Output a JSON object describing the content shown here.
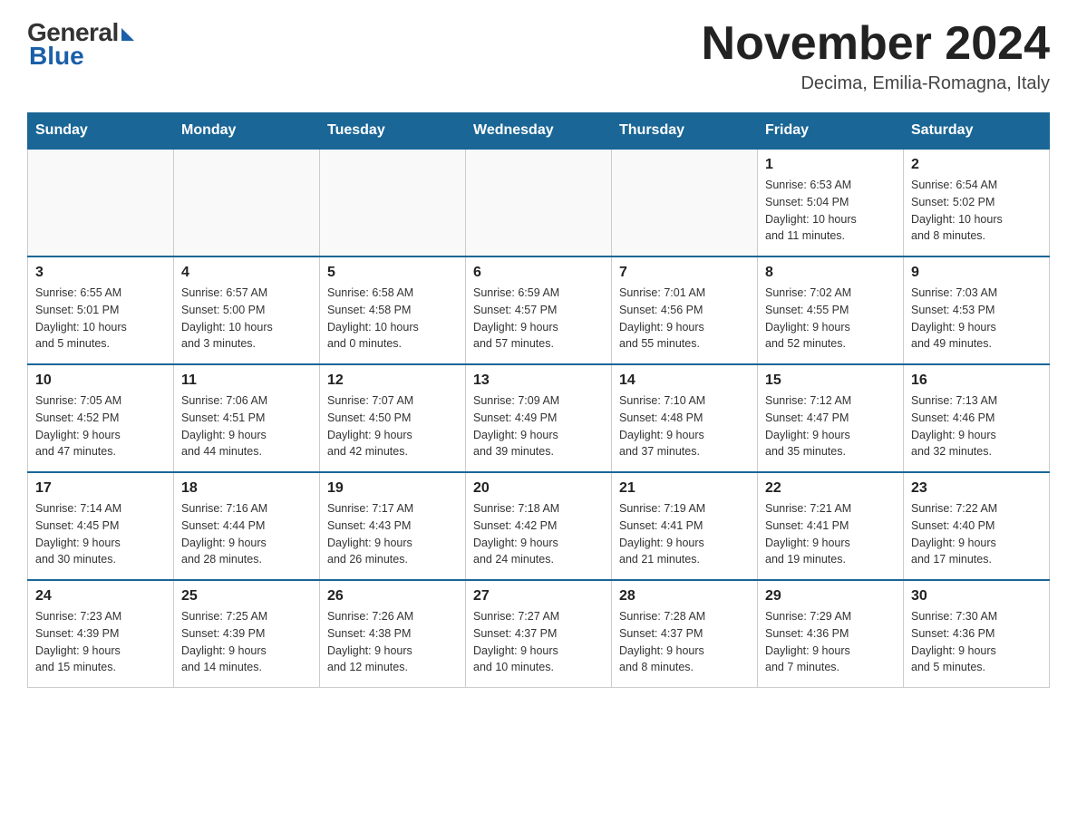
{
  "header": {
    "logo": {
      "general": "General",
      "blue": "Blue"
    },
    "title": "November 2024",
    "subtitle": "Decima, Emilia-Romagna, Italy"
  },
  "weekdays": [
    "Sunday",
    "Monday",
    "Tuesday",
    "Wednesday",
    "Thursday",
    "Friday",
    "Saturday"
  ],
  "weeks": [
    [
      {
        "day": "",
        "info": ""
      },
      {
        "day": "",
        "info": ""
      },
      {
        "day": "",
        "info": ""
      },
      {
        "day": "",
        "info": ""
      },
      {
        "day": "",
        "info": ""
      },
      {
        "day": "1",
        "info": "Sunrise: 6:53 AM\nSunset: 5:04 PM\nDaylight: 10 hours\nand 11 minutes."
      },
      {
        "day": "2",
        "info": "Sunrise: 6:54 AM\nSunset: 5:02 PM\nDaylight: 10 hours\nand 8 minutes."
      }
    ],
    [
      {
        "day": "3",
        "info": "Sunrise: 6:55 AM\nSunset: 5:01 PM\nDaylight: 10 hours\nand 5 minutes."
      },
      {
        "day": "4",
        "info": "Sunrise: 6:57 AM\nSunset: 5:00 PM\nDaylight: 10 hours\nand 3 minutes."
      },
      {
        "day": "5",
        "info": "Sunrise: 6:58 AM\nSunset: 4:58 PM\nDaylight: 10 hours\nand 0 minutes."
      },
      {
        "day": "6",
        "info": "Sunrise: 6:59 AM\nSunset: 4:57 PM\nDaylight: 9 hours\nand 57 minutes."
      },
      {
        "day": "7",
        "info": "Sunrise: 7:01 AM\nSunset: 4:56 PM\nDaylight: 9 hours\nand 55 minutes."
      },
      {
        "day": "8",
        "info": "Sunrise: 7:02 AM\nSunset: 4:55 PM\nDaylight: 9 hours\nand 52 minutes."
      },
      {
        "day": "9",
        "info": "Sunrise: 7:03 AM\nSunset: 4:53 PM\nDaylight: 9 hours\nand 49 minutes."
      }
    ],
    [
      {
        "day": "10",
        "info": "Sunrise: 7:05 AM\nSunset: 4:52 PM\nDaylight: 9 hours\nand 47 minutes."
      },
      {
        "day": "11",
        "info": "Sunrise: 7:06 AM\nSunset: 4:51 PM\nDaylight: 9 hours\nand 44 minutes."
      },
      {
        "day": "12",
        "info": "Sunrise: 7:07 AM\nSunset: 4:50 PM\nDaylight: 9 hours\nand 42 minutes."
      },
      {
        "day": "13",
        "info": "Sunrise: 7:09 AM\nSunset: 4:49 PM\nDaylight: 9 hours\nand 39 minutes."
      },
      {
        "day": "14",
        "info": "Sunrise: 7:10 AM\nSunset: 4:48 PM\nDaylight: 9 hours\nand 37 minutes."
      },
      {
        "day": "15",
        "info": "Sunrise: 7:12 AM\nSunset: 4:47 PM\nDaylight: 9 hours\nand 35 minutes."
      },
      {
        "day": "16",
        "info": "Sunrise: 7:13 AM\nSunset: 4:46 PM\nDaylight: 9 hours\nand 32 minutes."
      }
    ],
    [
      {
        "day": "17",
        "info": "Sunrise: 7:14 AM\nSunset: 4:45 PM\nDaylight: 9 hours\nand 30 minutes."
      },
      {
        "day": "18",
        "info": "Sunrise: 7:16 AM\nSunset: 4:44 PM\nDaylight: 9 hours\nand 28 minutes."
      },
      {
        "day": "19",
        "info": "Sunrise: 7:17 AM\nSunset: 4:43 PM\nDaylight: 9 hours\nand 26 minutes."
      },
      {
        "day": "20",
        "info": "Sunrise: 7:18 AM\nSunset: 4:42 PM\nDaylight: 9 hours\nand 24 minutes."
      },
      {
        "day": "21",
        "info": "Sunrise: 7:19 AM\nSunset: 4:41 PM\nDaylight: 9 hours\nand 21 minutes."
      },
      {
        "day": "22",
        "info": "Sunrise: 7:21 AM\nSunset: 4:41 PM\nDaylight: 9 hours\nand 19 minutes."
      },
      {
        "day": "23",
        "info": "Sunrise: 7:22 AM\nSunset: 4:40 PM\nDaylight: 9 hours\nand 17 minutes."
      }
    ],
    [
      {
        "day": "24",
        "info": "Sunrise: 7:23 AM\nSunset: 4:39 PM\nDaylight: 9 hours\nand 15 minutes."
      },
      {
        "day": "25",
        "info": "Sunrise: 7:25 AM\nSunset: 4:39 PM\nDaylight: 9 hours\nand 14 minutes."
      },
      {
        "day": "26",
        "info": "Sunrise: 7:26 AM\nSunset: 4:38 PM\nDaylight: 9 hours\nand 12 minutes."
      },
      {
        "day": "27",
        "info": "Sunrise: 7:27 AM\nSunset: 4:37 PM\nDaylight: 9 hours\nand 10 minutes."
      },
      {
        "day": "28",
        "info": "Sunrise: 7:28 AM\nSunset: 4:37 PM\nDaylight: 9 hours\nand 8 minutes."
      },
      {
        "day": "29",
        "info": "Sunrise: 7:29 AM\nSunset: 4:36 PM\nDaylight: 9 hours\nand 7 minutes."
      },
      {
        "day": "30",
        "info": "Sunrise: 7:30 AM\nSunset: 4:36 PM\nDaylight: 9 hours\nand 5 minutes."
      }
    ]
  ]
}
